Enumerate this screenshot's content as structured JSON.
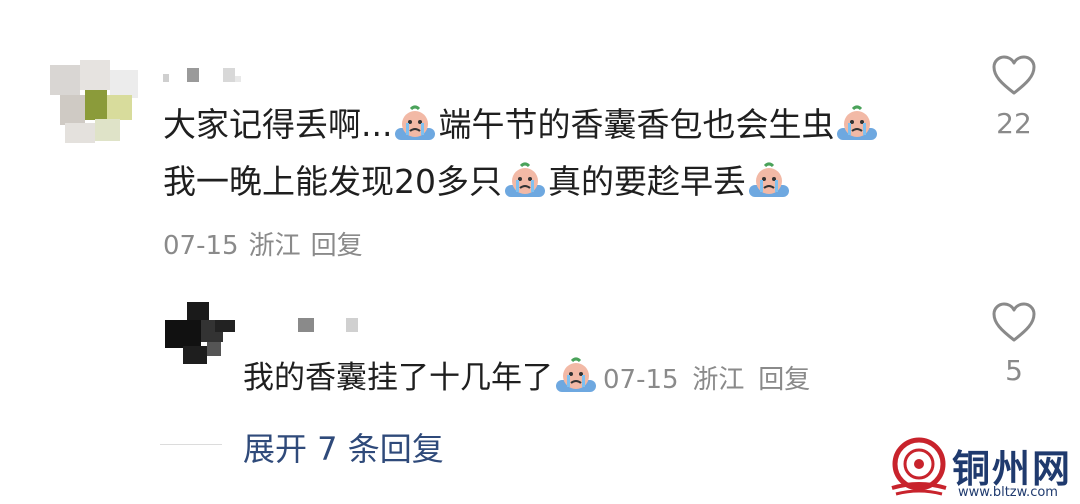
{
  "comment": {
    "text_line1_a": "大家记得丢啊...",
    "text_line1_b": "端午节的香囊香包也会生虫",
    "text_line2_a": "我一晚上能发现20多只",
    "text_line2_b": "真的要趁早丢",
    "date": "07-15",
    "location": "浙江",
    "reply_label": "回复",
    "like_count": "22"
  },
  "reply": {
    "text": "我的香囊挂了十几年了",
    "date": "07-15",
    "location": "浙江",
    "reply_label": "回复",
    "like_count": "5"
  },
  "expand": {
    "label": "展开 7 条回复"
  },
  "watermark": {
    "name": "铜州网",
    "url": "www.bltzw.com"
  },
  "icons": {
    "like": "heart-outline-icon",
    "emoji": "crying-face-emoji"
  }
}
